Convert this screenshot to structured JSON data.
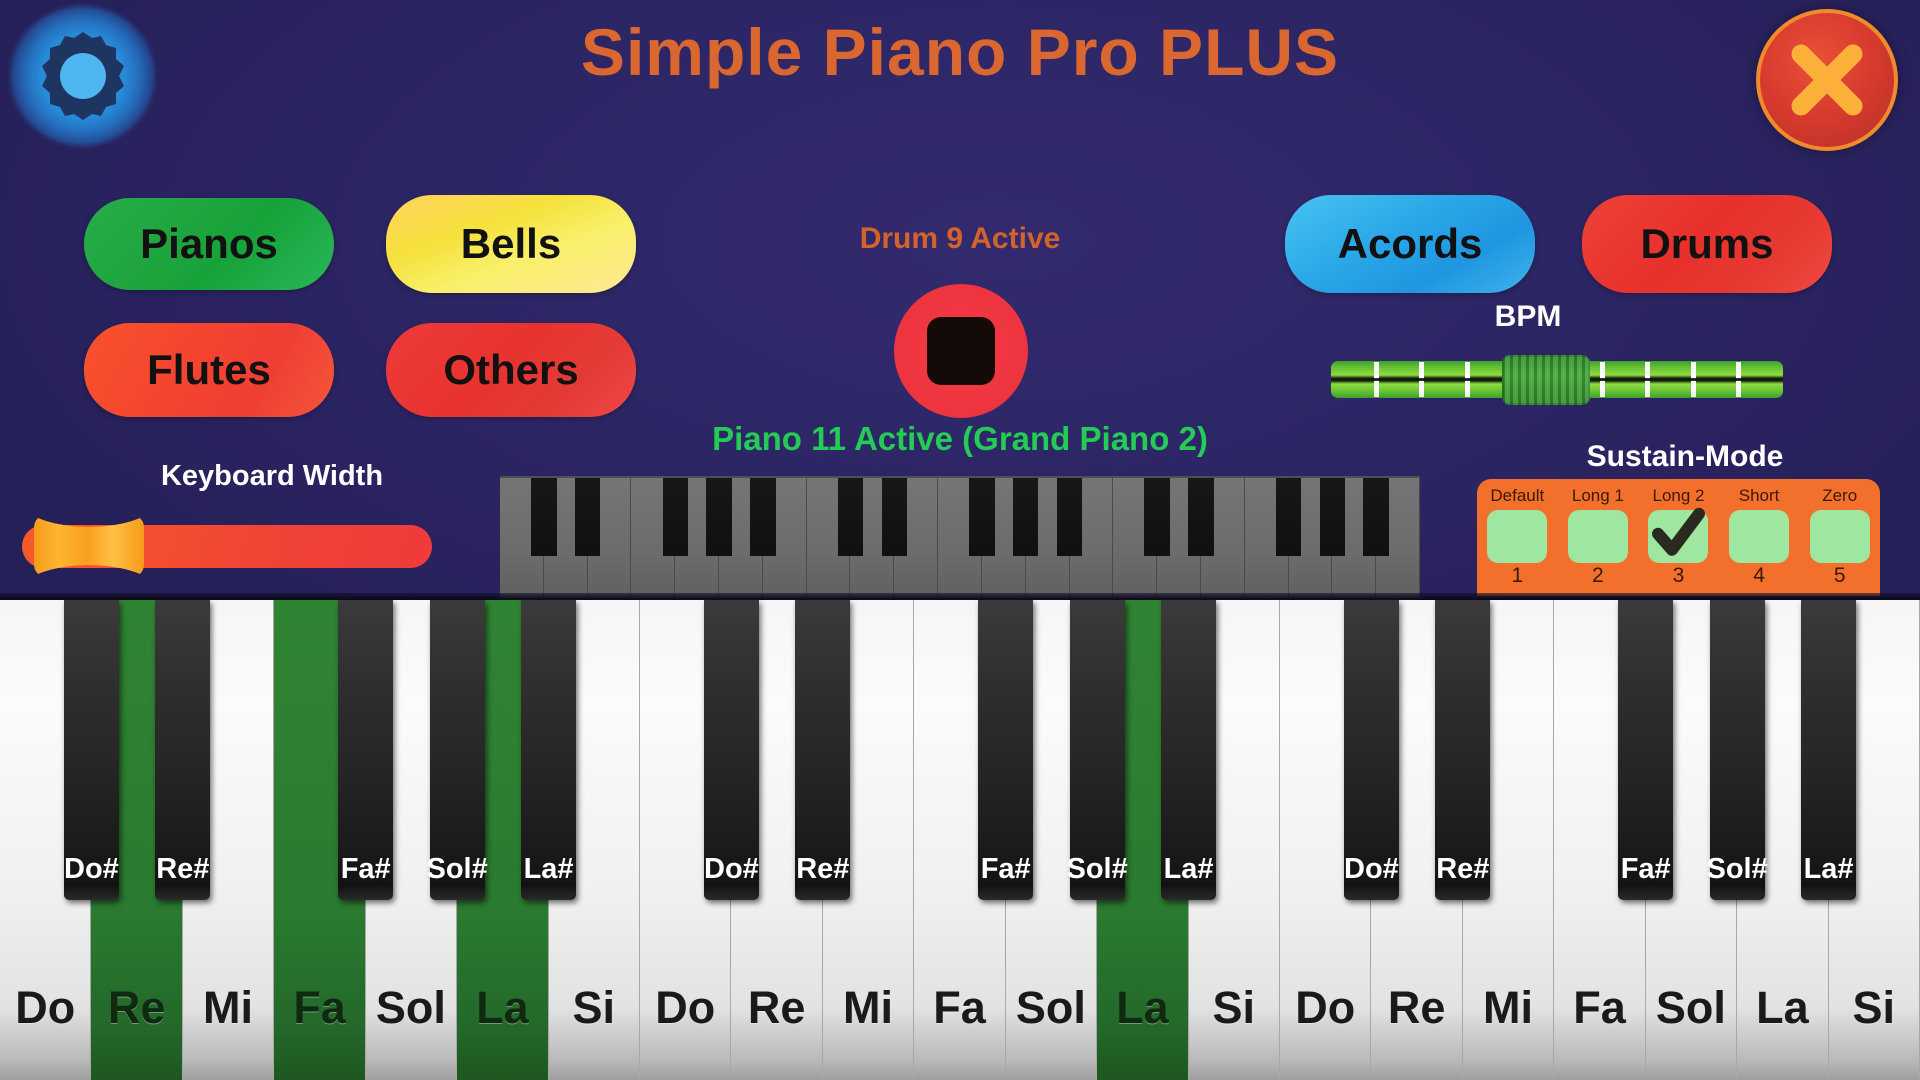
{
  "app": {
    "title": "Simple Piano Pro PLUS",
    "title_color": "#d9672f",
    "background_color": "#2e2767"
  },
  "header": {
    "settings_icon": "gear-icon",
    "close_icon": "close-x-icon"
  },
  "categories": {
    "pianos": "Pianos",
    "bells": "Bells",
    "flutes": "Flutes",
    "others": "Others",
    "acords": "Acords",
    "drums": "Drums"
  },
  "drum": {
    "status": "Drum 9 Active",
    "status_color": "#d4632b",
    "pad_icon": "drum-pad-icon"
  },
  "bpm": {
    "label": "BPM",
    "thumb_position_percent": 47
  },
  "keyboard_width": {
    "label": "Keyboard Width",
    "thumb_position_percent": 2
  },
  "piano_status": {
    "text": "Piano 11 Active (Grand Piano 2)",
    "color": "#22cc55"
  },
  "sustain": {
    "title": "Sustain-Mode",
    "selected_index": 2,
    "check_glyph": "check-icon",
    "items": [
      {
        "name": "Default",
        "number": "1"
      },
      {
        "name": "Long 1",
        "number": "2"
      },
      {
        "name": "Long 2",
        "number": "3"
      },
      {
        "name": "Short",
        "number": "4"
      },
      {
        "name": "Zero",
        "number": "5"
      }
    ]
  },
  "keyboard": {
    "white_keys": [
      {
        "label": "Do",
        "active": false
      },
      {
        "label": "Re",
        "active": true
      },
      {
        "label": "Mi",
        "active": false
      },
      {
        "label": "Fa",
        "active": true
      },
      {
        "label": "Sol",
        "active": false
      },
      {
        "label": "La",
        "active": true
      },
      {
        "label": "Si",
        "active": false
      },
      {
        "label": "Do",
        "active": false
      },
      {
        "label": "Re",
        "active": false
      },
      {
        "label": "Mi",
        "active": false
      },
      {
        "label": "Fa",
        "active": false
      },
      {
        "label": "Sol",
        "active": false
      },
      {
        "label": "La",
        "active": true
      },
      {
        "label": "Si",
        "active": false
      },
      {
        "label": "Do",
        "active": false
      },
      {
        "label": "Re",
        "active": false
      },
      {
        "label": "Mi",
        "active": false
      },
      {
        "label": "Fa",
        "active": false
      },
      {
        "label": "Sol",
        "active": false
      },
      {
        "label": "La",
        "active": false
      },
      {
        "label": "Si",
        "active": false
      }
    ],
    "black_keys": [
      {
        "label": "Do#",
        "after_white": 0
      },
      {
        "label": "Re#",
        "after_white": 1
      },
      {
        "label": "Fa#",
        "after_white": 3
      },
      {
        "label": "Sol#",
        "after_white": 4
      },
      {
        "label": "La#",
        "after_white": 5
      },
      {
        "label": "Do#",
        "after_white": 7
      },
      {
        "label": "Re#",
        "after_white": 8
      },
      {
        "label": "Fa#",
        "after_white": 10
      },
      {
        "label": "Sol#",
        "after_white": 11
      },
      {
        "label": "La#",
        "after_white": 12
      },
      {
        "label": "Do#",
        "after_white": 14
      },
      {
        "label": "Re#",
        "after_white": 15
      },
      {
        "label": "Fa#",
        "after_white": 17
      },
      {
        "label": "Sol#",
        "after_white": 18
      },
      {
        "label": "La#",
        "after_white": 19
      }
    ]
  },
  "mini_keyboard": {
    "white_key_count": 21,
    "black_after": [
      0,
      1,
      3,
      4,
      5,
      7,
      8,
      10,
      11,
      12,
      14,
      15,
      17,
      18,
      19
    ]
  }
}
